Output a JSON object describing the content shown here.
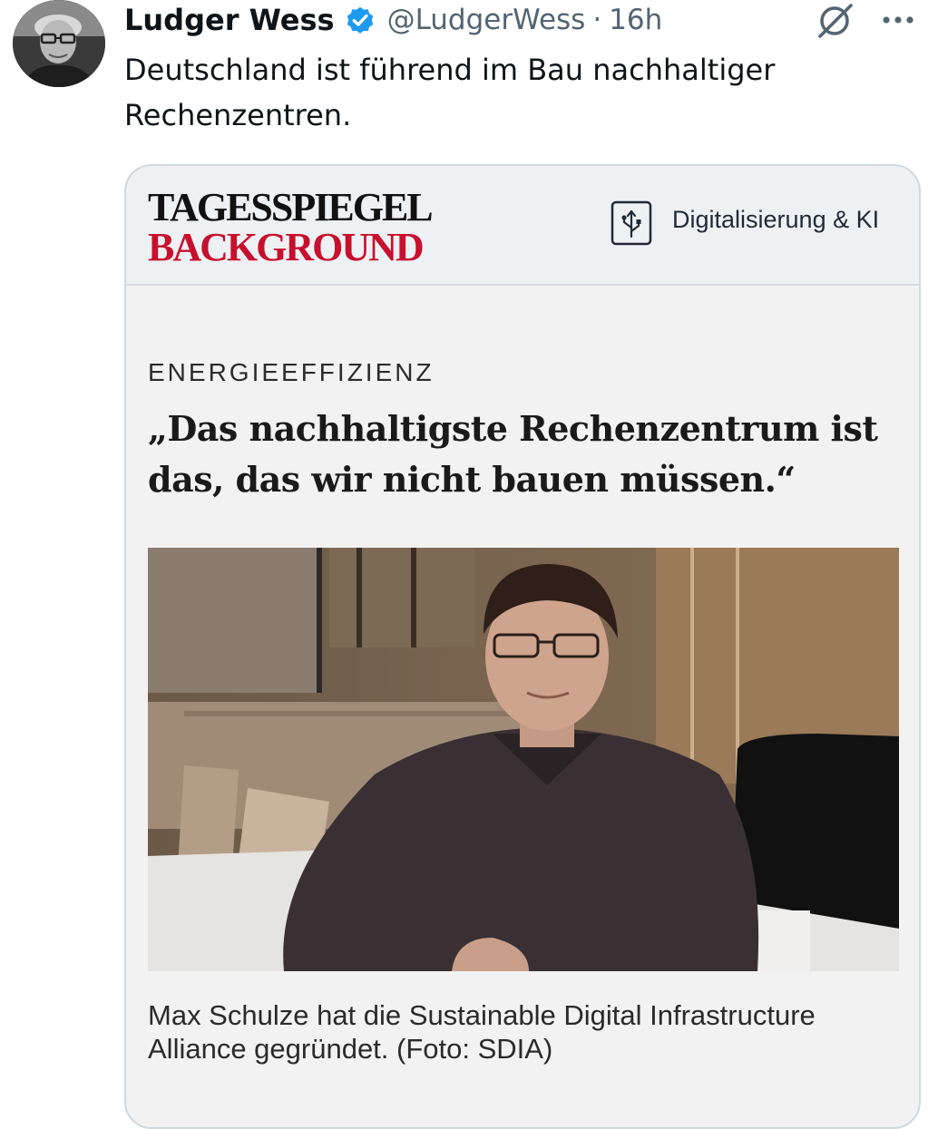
{
  "tweet": {
    "author_name": "Ludger Wess",
    "handle": "@LudgerWess",
    "separator": "·",
    "time": "16h",
    "text": "Deutschland ist führend im Bau nachhaltiger Rechenzentren."
  },
  "card": {
    "brand_top": "TAGESSPIEGEL",
    "brand_bottom": "BACKGROUND",
    "section_label": "Digitalisierung & KI",
    "kicker": "ENERGIEEFFIZIENZ",
    "headline": "„Das nachhaltigste Rechenzentrum ist das, das wir nicht bauen müssen.“",
    "caption": "Max Schulze hat die Sustainable Digital Infrastructure Alliance gegründet. (Foto: SDIA)"
  },
  "icons": {
    "verified": "verified-badge-icon",
    "grok": "grok-icon",
    "more": "more-icon",
    "section": "section-icon"
  },
  "colors": {
    "verified": "#1d9bf0",
    "brand_red": "#c8102e",
    "secondary_text": "#536471",
    "card_border": "#cfd9de"
  }
}
